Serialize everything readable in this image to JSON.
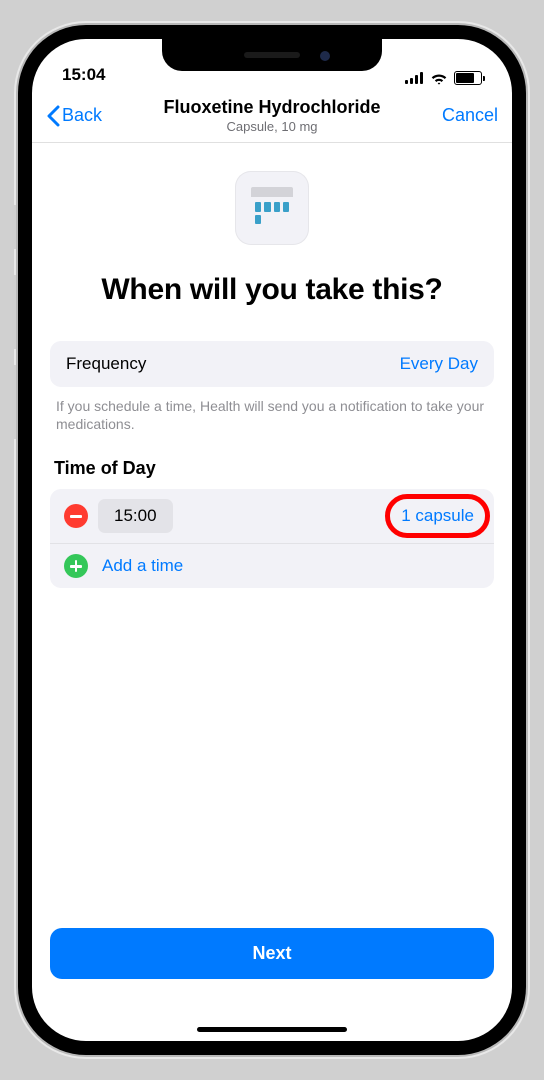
{
  "status": {
    "time": "15:04"
  },
  "nav": {
    "back": "Back",
    "title": "Fluoxetine Hydrochloride",
    "subtitle": "Capsule, 10 mg",
    "cancel": "Cancel"
  },
  "heading": "When will you take this?",
  "frequency": {
    "label": "Frequency",
    "value": "Every Day"
  },
  "hint": "If you schedule a time, Health will send you a notification to take your medications.",
  "timeOfDay": {
    "label": "Time of Day",
    "entries": [
      {
        "time": "15:00",
        "dose": "1 capsule"
      }
    ],
    "addLabel": "Add a time"
  },
  "nextLabel": "Next"
}
